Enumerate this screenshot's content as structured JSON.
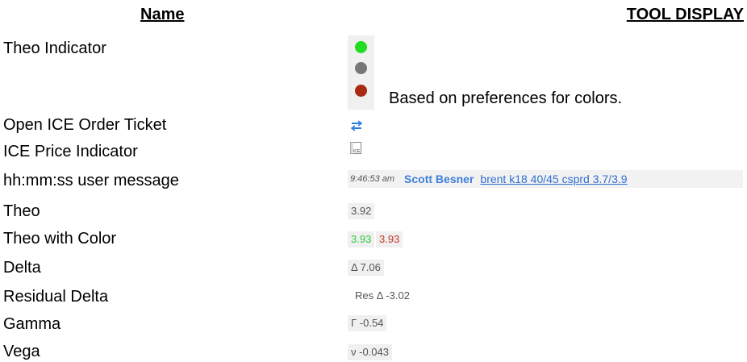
{
  "headers": {
    "name": "Name",
    "tool_display": "TOOL DISPLAY"
  },
  "rows": [
    {
      "name": "Theo Indicator"
    },
    {
      "name": "Open ICE Order Ticket"
    },
    {
      "name": "ICE Price Indicator"
    },
    {
      "name": "hh:mm:ss user message"
    },
    {
      "name": "Theo"
    },
    {
      "name": "Theo with Color"
    },
    {
      "name": "Delta"
    },
    {
      "name": "Residual Delta"
    },
    {
      "name": "Gamma"
    },
    {
      "name": "Vega"
    }
  ],
  "theo_indicator": {
    "colors": [
      "#22dd22",
      "#777777",
      "#a82a10"
    ],
    "note": "Based on preferences for colors."
  },
  "icons": {
    "order_ticket": "swap-arrows-icon",
    "ice_price": "ice-icon",
    "ice_label": "ICE"
  },
  "message": {
    "time": "9:46:53 am",
    "user": "Scott Besner",
    "text": "brent k18 40/45 csprd 3.7/3.9"
  },
  "values": {
    "theo": "3.92",
    "theo_color_up": "3.93",
    "theo_color_down": "3.93",
    "delta": "Δ 7.06",
    "residual_delta": "Res Δ -3.02",
    "gamma": "Γ -0.54",
    "vega": "ν -0.043"
  }
}
